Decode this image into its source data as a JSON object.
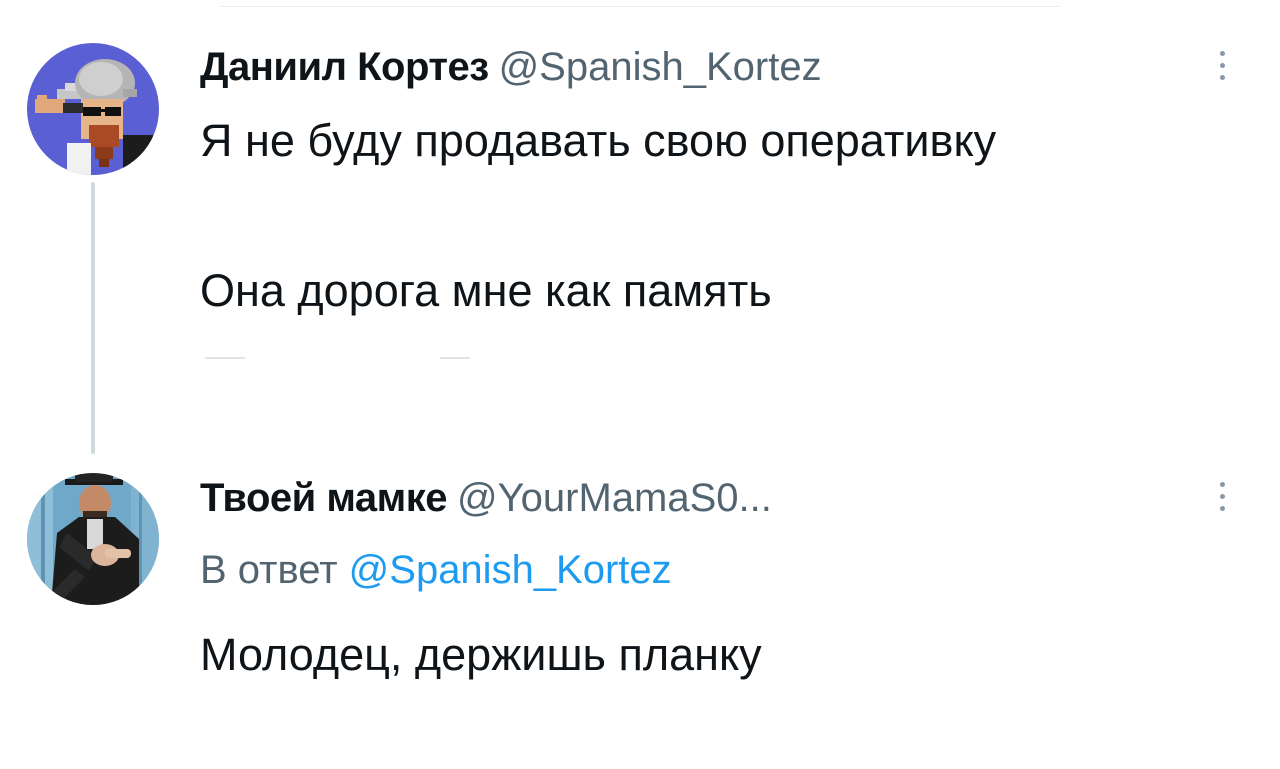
{
  "thread": {
    "tweets": [
      {
        "author_name": "Даниил Кортез",
        "author_handle": "@Spanish_Kortez",
        "avatar_icon": "pixel-cowboy-avatar",
        "more_icon": "more-options-icon",
        "lines": [
          "Я не буду продавать свою оперативку",
          "Она дорога мне как память"
        ]
      },
      {
        "author_name": "Твоей мамке",
        "author_handle": "@YourMamaS0...",
        "avatar_icon": "pointing-man-photo-avatar",
        "more_icon": "more-options-icon",
        "reply_prefix": "В ответ",
        "reply_to": "@Spanish_Kortez",
        "lines": [
          "Молодец, держишь планку"
        ]
      }
    ]
  },
  "colors": {
    "text": "#0f1419",
    "secondary": "#536471",
    "link": "#1d9bf0",
    "thread_line": "#cfd9de",
    "avatar1_bg": "#5b5fd4",
    "avatar2_bg": "#6fa8c9"
  }
}
